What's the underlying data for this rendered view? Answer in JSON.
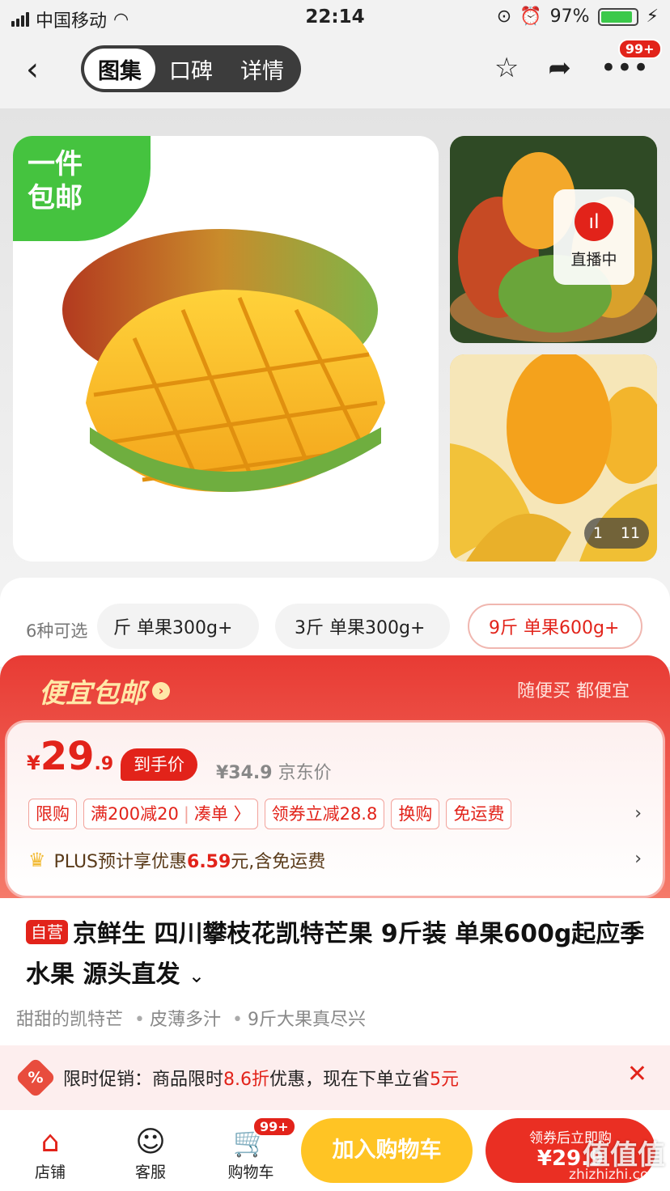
{
  "status": {
    "carrier": "中国移动",
    "time": "22:14",
    "battery": "97%"
  },
  "nav": {
    "tabs": [
      {
        "label": "图集"
      },
      {
        "label": "口碑"
      },
      {
        "label": "详情"
      }
    ],
    "badge": "99+"
  },
  "gallery": {
    "free_ship_line1": "一件",
    "free_ship_line2": "包邮",
    "live_label": "直播中",
    "counter_current": "1",
    "counter_total": "11"
  },
  "variants": {
    "label": "6种可选",
    "options": [
      "斤 单果300g+",
      "3斤 单果300g+",
      "9斤 单果600g+"
    ]
  },
  "promo": {
    "title": "便宜包邮",
    "subtitle": "随便买 都便宜",
    "price_currency": "¥",
    "price_int": "29",
    "price_dec": ".9",
    "price_tag": "到手价",
    "jd_price": "¥34.9",
    "jd_price_label": "京东价",
    "chips": [
      "限购",
      "满200减20",
      "凑单 〉",
      "领券立减28.8",
      "换购",
      "免运费"
    ],
    "plus_pre": "PLUS预计享优惠",
    "plus_val": "6.59",
    "plus_post": "元,含免运费"
  },
  "product": {
    "self_op": "自营",
    "title": "京鲜生 四川攀枝花凯特芒果 9斤装 单果600g起应季水果 源头直发",
    "selling_points": [
      "甜甜的凯特芒",
      "皮薄多汁",
      "9斤大果真尽兴"
    ]
  },
  "promo_bar": {
    "pre": "限时促销：商品限时",
    "discount": "8.6折",
    "mid": "优惠，现在下单立省",
    "save": "5元"
  },
  "bottom": {
    "store": "店铺",
    "service": "客服",
    "cart": "购物车",
    "cart_badge": "99+",
    "add_cart": "加入购物车",
    "buy_line1": "领券后立即购",
    "buy_line2": "¥29.9"
  },
  "watermark": {
    "main": "值值值",
    "url": "zhizhizhi.com"
  },
  "colors": {
    "accent_red": "#e2231a",
    "cart_yellow": "#ffc424",
    "ship_green": "#45c33f"
  }
}
